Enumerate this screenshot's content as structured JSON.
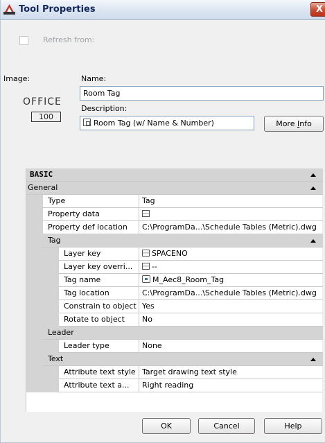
{
  "window": {
    "title": "Tool Properties",
    "close": "X"
  },
  "refresh": {
    "label": "Refresh from:"
  },
  "image_label": "Image:",
  "name_label": "Name:",
  "name_value": "Room Tag",
  "description_label": "Description:",
  "description_value": "Room Tag (w/ Name & Number)",
  "more_info": {
    "pre": "More ",
    "key": "I",
    "post": "nfo"
  },
  "office_image": {
    "text": "OFFICE",
    "number": "100"
  },
  "grid": {
    "basic": "BASIC",
    "general": "General",
    "type": {
      "label": "Type",
      "value": "Tag"
    },
    "property_data": {
      "label": "Property data"
    },
    "property_def_location": {
      "label": "Property def location",
      "value": "C:\\ProgramDa...\\Schedule Tables (Metric).dwg"
    },
    "tag_cat": "Tag",
    "layer_key": {
      "label": "Layer key",
      "value": "SPACENO"
    },
    "layer_key_overrides": {
      "label": "Layer key overri...",
      "value": "--"
    },
    "tag_name": {
      "label": "Tag name",
      "value": "M_Aec8_Room_Tag"
    },
    "tag_location": {
      "label": "Tag location",
      "value": "C:\\ProgramDa...\\Schedule Tables (Metric).dwg"
    },
    "constrain": {
      "label": "Constrain to object",
      "value": "Yes"
    },
    "rotate": {
      "label": "Rotate to object",
      "value": "No"
    },
    "leader_cat": "Leader",
    "leader_type": {
      "label": "Leader type",
      "value": "None"
    },
    "text_cat": "Text",
    "attr_text_style": {
      "label": "Attribute text style",
      "value": "Target drawing text style"
    },
    "attr_text_align": {
      "label": "Attribute text a...",
      "value": "Right reading"
    }
  },
  "buttons": {
    "ok": "OK",
    "cancel": "Cancel",
    "help": "Help"
  },
  "colors": {
    "title": "#15295a",
    "close": "#c94a30",
    "category": "#d4d4d4",
    "icon_red": "#c0392b"
  }
}
